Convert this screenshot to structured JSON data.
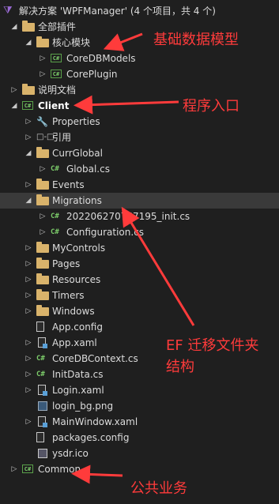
{
  "solution": {
    "title": "解决方案 'WPFManager' (4 个项目，共 4 个)"
  },
  "tree": [
    {
      "label": "全部插件",
      "icon": "folder-icon",
      "depth": 1,
      "arrow": "expanded"
    },
    {
      "label": "核心模块",
      "icon": "folder-icon",
      "depth": 2,
      "arrow": "expanded"
    },
    {
      "label": "CoreDBModels",
      "icon": "csharp-project-icon",
      "depth": 3,
      "arrow": "collapsed"
    },
    {
      "label": "CorePlugin",
      "icon": "csharp-project-icon",
      "depth": 3,
      "arrow": "collapsed"
    },
    {
      "label": "说明文档",
      "icon": "folder-icon",
      "depth": 1,
      "arrow": "collapsed"
    },
    {
      "label": "Client",
      "icon": "csharp-project-icon",
      "depth": 1,
      "arrow": "expanded",
      "bold": true
    },
    {
      "label": "Properties",
      "icon": "wrench-icon",
      "depth": 2,
      "arrow": "collapsed"
    },
    {
      "label": "引用",
      "icon": "references-icon",
      "depth": 2,
      "arrow": "collapsed"
    },
    {
      "label": "CurrGlobal",
      "icon": "folder-open-icon",
      "depth": 2,
      "arrow": "expanded"
    },
    {
      "label": "Global.cs",
      "icon": "csharp-file-icon",
      "depth": 3,
      "arrow": "collapsed"
    },
    {
      "label": "Events",
      "icon": "folder-icon",
      "depth": 2,
      "arrow": "collapsed"
    },
    {
      "label": "Migrations",
      "icon": "folder-open-icon",
      "depth": 2,
      "arrow": "expanded",
      "selected": true
    },
    {
      "label": "202206270757195_init.cs",
      "icon": "csharp-file-icon",
      "depth": 3,
      "arrow": "collapsed"
    },
    {
      "label": "Configuration.cs",
      "icon": "csharp-file-icon",
      "depth": 3,
      "arrow": "collapsed"
    },
    {
      "label": "MyControls",
      "icon": "folder-icon",
      "depth": 2,
      "arrow": "collapsed"
    },
    {
      "label": "Pages",
      "icon": "folder-icon",
      "depth": 2,
      "arrow": "collapsed"
    },
    {
      "label": "Resources",
      "icon": "folder-icon",
      "depth": 2,
      "arrow": "collapsed"
    },
    {
      "label": "Timers",
      "icon": "folder-icon",
      "depth": 2,
      "arrow": "collapsed"
    },
    {
      "label": "Windows",
      "icon": "folder-icon",
      "depth": 2,
      "arrow": "collapsed"
    },
    {
      "label": "App.config",
      "icon": "config-file-icon",
      "depth": 2,
      "arrow": "none"
    },
    {
      "label": "App.xaml",
      "icon": "xaml-file-icon",
      "depth": 2,
      "arrow": "collapsed"
    },
    {
      "label": "CoreDBContext.cs",
      "icon": "csharp-file-icon",
      "depth": 2,
      "arrow": "collapsed"
    },
    {
      "label": "InitData.cs",
      "icon": "csharp-file-icon",
      "depth": 2,
      "arrow": "collapsed"
    },
    {
      "label": "Login.xaml",
      "icon": "xaml-file-icon",
      "depth": 2,
      "arrow": "collapsed"
    },
    {
      "label": "login_bg.png",
      "icon": "image-file-icon",
      "depth": 2,
      "arrow": "none"
    },
    {
      "label": "MainWindow.xaml",
      "icon": "xaml-file-icon",
      "depth": 2,
      "arrow": "collapsed"
    },
    {
      "label": "packages.config",
      "icon": "config-file-icon",
      "depth": 2,
      "arrow": "none"
    },
    {
      "label": "ysdr.ico",
      "icon": "ico-file-icon",
      "depth": 2,
      "arrow": "none"
    },
    {
      "label": "Common",
      "icon": "csharp-project-icon",
      "depth": 1,
      "arrow": "collapsed"
    }
  ],
  "annotations": {
    "base_model": "基础数据模型",
    "entry": "程序入口",
    "ef_line1": "EF 迁移文件夹",
    "ef_line2": "结构",
    "common": "公共业务"
  },
  "colors": {
    "annotation": "#ff3b3b",
    "background": "#1f1f1f",
    "selected_row": "#3a3a3a"
  }
}
